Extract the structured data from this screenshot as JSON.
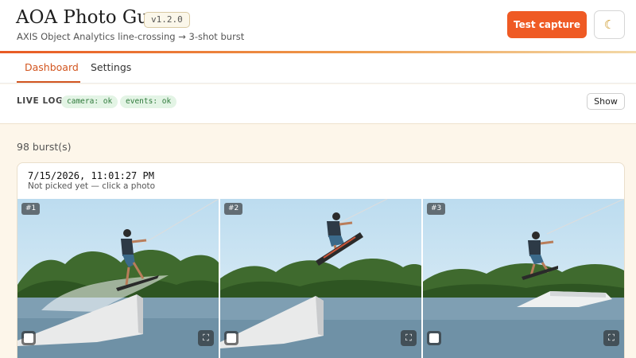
{
  "header": {
    "title": "AOA Photo Gun",
    "version": "v1.2.0",
    "subtitle": "AXIS Object Analytics line-crossing → 3-shot burst",
    "test_capture_label": "Test capture",
    "theme_icon": "moon-icon",
    "theme_glyph": "☾"
  },
  "tabs": [
    {
      "label": "Dashboard",
      "active": true
    },
    {
      "label": "Settings",
      "active": false
    }
  ],
  "live_log": {
    "label": "LIVE LOG",
    "statuses": [
      "camera: ok",
      "events: ok"
    ],
    "show_label": "Show"
  },
  "bursts": {
    "count_label": "98 burst(s)",
    "latest": {
      "timestamp": "7/15/2026, 11:01:27 PM",
      "hint": "Not picked yet — click a photo",
      "photos": [
        {
          "badge": "#1"
        },
        {
          "badge": "#2"
        },
        {
          "badge": "#3"
        }
      ]
    }
  },
  "icons": {
    "expand_glyph": "⛶"
  },
  "colors": {
    "accent": "#ef5a24",
    "tab_active": "#d2551f",
    "status_bg": "#e3f4e5",
    "status_text": "#2f7a3b"
  }
}
